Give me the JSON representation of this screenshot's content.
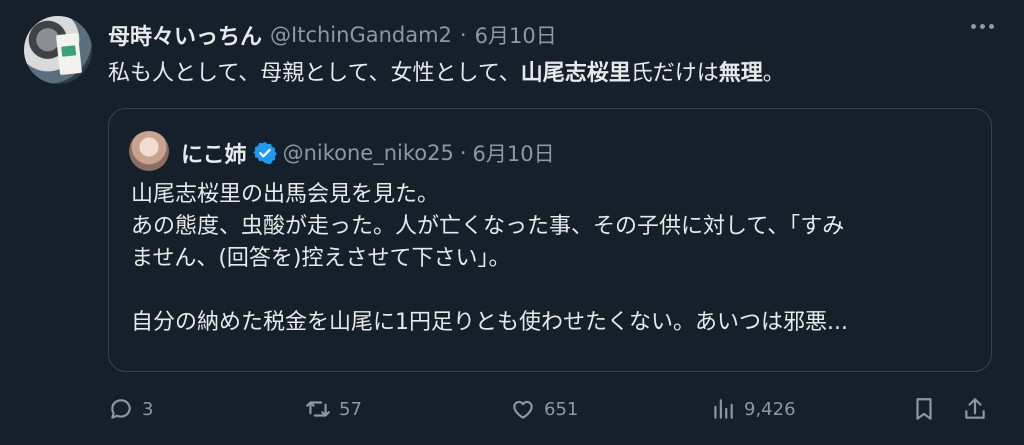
{
  "tweet": {
    "author_name": "母時々いっちん",
    "handle": "@ItchinGandam2",
    "separator": "·",
    "date": "6月10日",
    "text_parts": [
      "私も人として、母親として、女性として、",
      "山尾志桜里",
      "氏だけは",
      "無理",
      "。"
    ]
  },
  "quote": {
    "author_name": "にこ姉",
    "handle": "@nikone_niko25",
    "separator": "·",
    "date": "6月10日",
    "lines": [
      "山尾志桜里の出馬会見を見た。",
      "あの態度、虫酸が走った。人が亡くなった事、その子供に対して、「すみ",
      "ません、(回答を)控えさせて下さい」。",
      "",
      "自分の納めた税金を山尾に1円足りとも使わせたくない。あいつは邪悪..."
    ]
  },
  "actions": {
    "replies": "3",
    "retweets": "57",
    "likes": "651",
    "views": "9,426"
  },
  "colors": {
    "background": "#15202b",
    "text": "#e7e9ea",
    "muted": "#8b98a5",
    "border": "#38444d",
    "verified": "#1d9bf0"
  },
  "icons": [
    "more-icon",
    "verified-badge-icon",
    "reply-icon",
    "retweet-icon",
    "like-icon",
    "views-icon",
    "bookmark-icon",
    "share-icon"
  ]
}
